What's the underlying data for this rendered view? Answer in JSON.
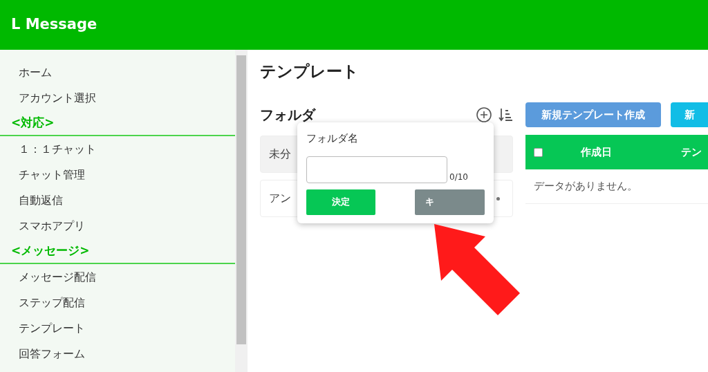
{
  "header": {
    "logo": "L Message"
  },
  "sidebar": {
    "items": [
      {
        "kind": "link",
        "label": "ホーム"
      },
      {
        "kind": "link",
        "label": "アカウント選択"
      },
      {
        "kind": "section",
        "label": "<対応>"
      },
      {
        "kind": "link",
        "label": "１：１チャット"
      },
      {
        "kind": "link",
        "label": "チャット管理"
      },
      {
        "kind": "link",
        "label": "自動返信"
      },
      {
        "kind": "link",
        "label": "スマホアプリ"
      },
      {
        "kind": "section",
        "label": "<メッセージ>"
      },
      {
        "kind": "link",
        "label": "メッセージ配信"
      },
      {
        "kind": "link",
        "label": "ステップ配信"
      },
      {
        "kind": "link",
        "label": "テンプレート"
      },
      {
        "kind": "link",
        "label": "回答フォーム"
      }
    ]
  },
  "page_title": "テンプレート",
  "folders": {
    "title": "フォルダ",
    "items": [
      {
        "label": "未分",
        "selected": true
      },
      {
        "label": "アン",
        "selected": false
      }
    ]
  },
  "buttons": [
    "新規テンプレート作成",
    "新"
  ],
  "table": {
    "columns": [
      "作成日",
      "テン"
    ],
    "empty_message": "データがありません。"
  },
  "table_select_all": {
    "checked": false
  },
  "popup": {
    "label": "フォルダ名",
    "counter": "0/10",
    "confirm": "決定",
    "cancel": "キ"
  }
}
